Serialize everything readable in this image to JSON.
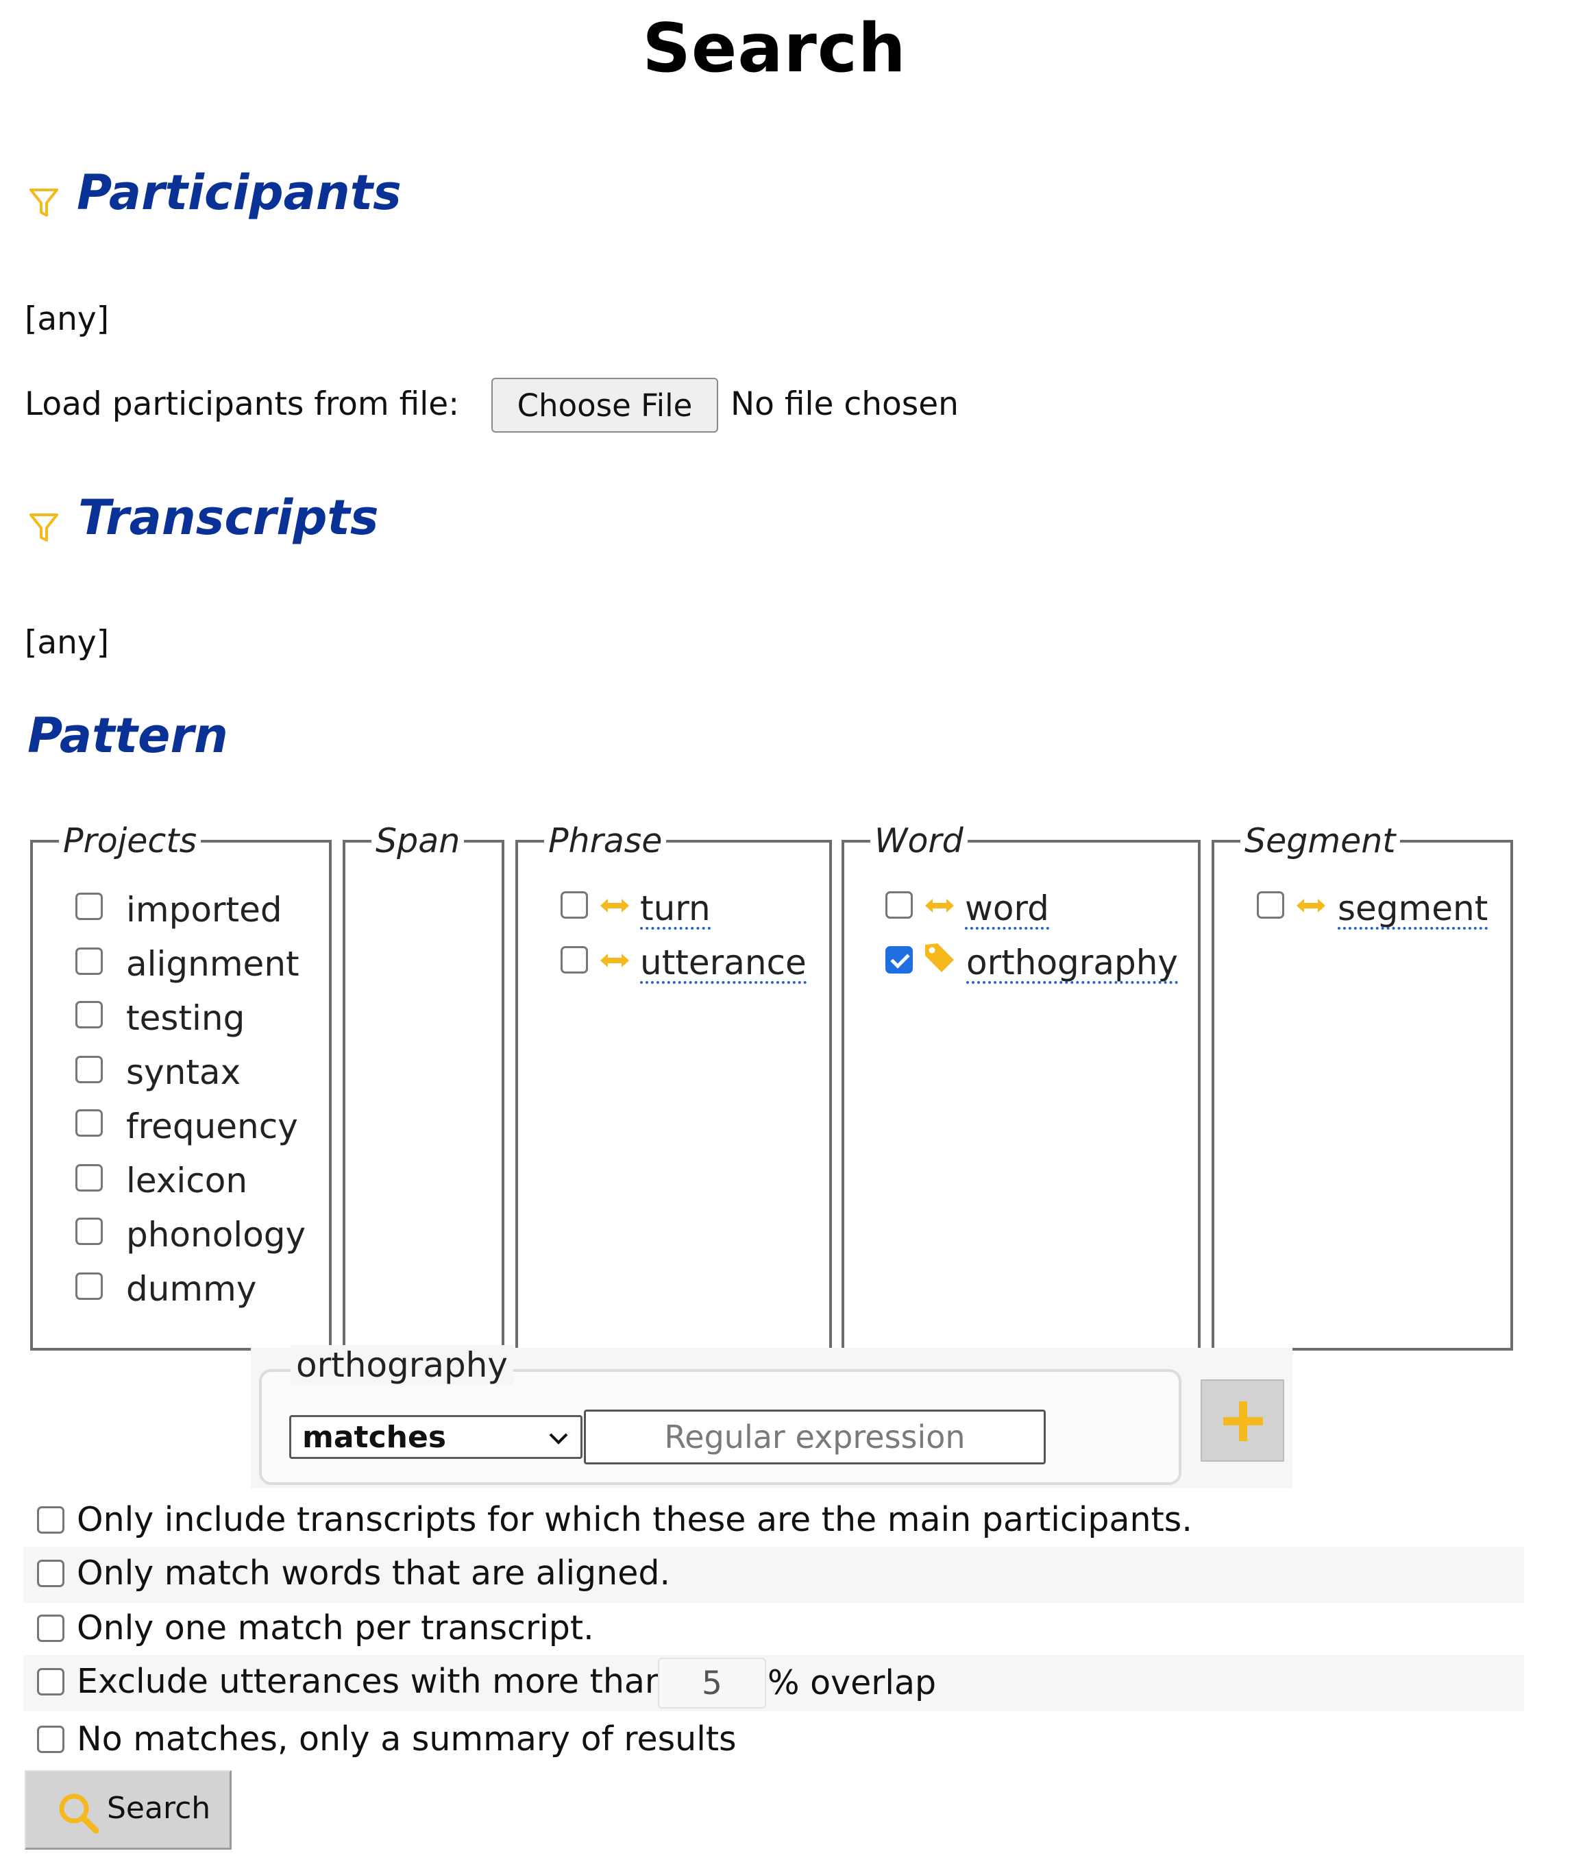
{
  "page": {
    "title": "Search"
  },
  "participants": {
    "title": "Participants",
    "filter_value": "[any]",
    "load_label": "Load participants from file:",
    "choose_file_label": "Choose File",
    "no_file_text": "No file chosen"
  },
  "transcripts": {
    "title": "Transcripts",
    "filter_value": "[any]"
  },
  "pattern": {
    "title": "Pattern",
    "columns": {
      "projects": {
        "legend": "Projects",
        "items": [
          {
            "label": "imported",
            "checked": false
          },
          {
            "label": "alignment",
            "checked": false
          },
          {
            "label": "testing",
            "checked": false
          },
          {
            "label": "syntax",
            "checked": false
          },
          {
            "label": "frequency",
            "checked": false
          },
          {
            "label": "lexicon",
            "checked": false
          },
          {
            "label": "phonology",
            "checked": false
          },
          {
            "label": "dummy",
            "checked": false
          }
        ]
      },
      "span": {
        "legend": "Span",
        "items": []
      },
      "phrase": {
        "legend": "Phrase",
        "items": [
          {
            "label": "turn",
            "checked": false,
            "icon": "bidirectional-arrow-icon"
          },
          {
            "label": "utterance",
            "checked": false,
            "icon": "bidirectional-arrow-icon"
          }
        ]
      },
      "word": {
        "legend": "Word",
        "items": [
          {
            "label": "word",
            "checked": false,
            "icon": "bidirectional-arrow-icon"
          },
          {
            "label": "orthography",
            "checked": true,
            "icon": "tag-icon"
          }
        ]
      },
      "segment": {
        "legend": "Segment",
        "items": [
          {
            "label": "segment",
            "checked": false,
            "icon": "bidirectional-arrow-icon"
          }
        ]
      }
    },
    "matcher": {
      "layer": "orthography",
      "operator": "matches",
      "regex_placeholder": "Regular expression",
      "regex_value": ""
    }
  },
  "options": {
    "main_participants": "Only include transcripts for which these are the main participants.",
    "aligned_only": "Only match words that are aligned.",
    "one_per_transcript": "Only one match per transcript.",
    "exclude_overlap_prefix": "Exclude utterances with more than",
    "overlap_threshold": "5",
    "exclude_overlap_suffix": "% overlap",
    "summary_only": "No matches, only a summary of results"
  },
  "search_button": {
    "label": "Search"
  },
  "colors": {
    "heading": "#0a3196",
    "accent_icon": "#f5b81d",
    "checkbox_checked": "#1f6fe0",
    "link_underline": "#2a62d0"
  }
}
